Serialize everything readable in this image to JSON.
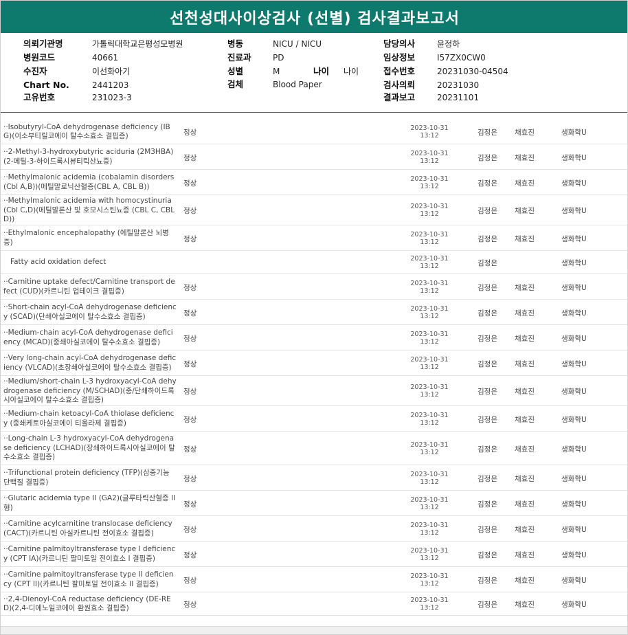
{
  "title": "선천성대사이상검사 (선별) 검사결과보고서",
  "info": {
    "col1": [
      {
        "key": "의뢰기관명",
        "value": "가톨릭대학교은평성모병원"
      },
      {
        "key": "병원코드",
        "value": "40661"
      },
      {
        "key": "수진자",
        "value": "이선화아기"
      },
      {
        "key": "Chart No.",
        "value": "2441203"
      },
      {
        "key": "고유번호",
        "value": "231023-3"
      }
    ],
    "col2": [
      {
        "key": "병동",
        "value": "NICU / NICU"
      },
      {
        "key": "진료과",
        "value": "PD"
      },
      {
        "key": "성별",
        "value": "M"
      },
      {
        "key": "검체",
        "value": "Blood Paper"
      }
    ],
    "age": {
      "key": "나이",
      "value": "나이"
    },
    "col3": [
      {
        "key": "담당의사",
        "value": "윤정하"
      },
      {
        "key": "임상정보",
        "value": "I57ZX0CW0"
      },
      {
        "key": "접수번호",
        "value": "20231030-04504"
      },
      {
        "key": "검사의뢰",
        "value": "20231030"
      },
      {
        "key": "결과보고",
        "value": "20231101"
      }
    ]
  },
  "rows": [
    {
      "name": "··Isobutyryl-CoA dehydrogenase deficiency (IBG)(이소부티릴코에이 탈수소효소 결핍증)",
      "result": "정상",
      "date": "2023-10-31",
      "time": "13:12",
      "p1": "김정은",
      "p2": "채효진",
      "dept": "생화학U"
    },
    {
      "name": "··2-Methyl-3-hydroxybutyric aciduria (2M3HBA)(2-메틸-3-하이드록시뷰티릭산뇨증)",
      "result": "정상",
      "date": "2023-10-31",
      "time": "13:12",
      "p1": "김정은",
      "p2": "채효진",
      "dept": "생화학U"
    },
    {
      "name": "··Methylmalonic acidemia (cobalamin disorders (Cbl A,B))(메틸말로닉산혈증(CBL A, CBL B))",
      "result": "정상",
      "date": "2023-10-31",
      "time": "13:12",
      "p1": "김정은",
      "p2": "채효진",
      "dept": "생화학U"
    },
    {
      "name": "··Methylmalonic acidemia with homocystinuria (Cbl C,D)(메틸말론산 및 호모시스틴뇨증 (CBL C, CBL D))",
      "result": "정상",
      "date": "2023-10-31",
      "time": "13:12",
      "p1": "김정은",
      "p2": "채효진",
      "dept": "생화학U"
    },
    {
      "name": "··Ethylmalonic encephalopathy (에틸말론산 뇌병증)",
      "result": "정상",
      "date": "2023-10-31",
      "time": "13:12",
      "p1": "김정은",
      "p2": "채효진",
      "dept": "생화학U"
    },
    {
      "name": "Fatty acid oxidation defect",
      "result": "",
      "date": "2023-10-31",
      "time": "13:12",
      "p1": "김정은",
      "p2": "",
      "dept": "생화학U",
      "plain": true
    },
    {
      "name": "··Carnitine uptake defect/Carnitine transport defect (CUD)(카르니틴 업테이크 결핍증)",
      "result": "정상",
      "date": "2023-10-31",
      "time": "13:12",
      "p1": "김정은",
      "p2": "채효진",
      "dept": "생화학U"
    },
    {
      "name": "··Short-chain acyl-CoA dehydrogenase deficiency (SCAD)(단쇄아실코에이 탈수소효소 결핍증)",
      "result": "정상",
      "date": "2023-10-31",
      "time": "13:12",
      "p1": "김정은",
      "p2": "채효진",
      "dept": "생화학U"
    },
    {
      "name": "··Medium-chain acyl-CoA dehydrogenase deficiency (MCAD)(중쇄아실코에이 탈수소효소 결핍증)",
      "result": "정상",
      "date": "2023-10-31",
      "time": "13:12",
      "p1": "김정은",
      "p2": "채효진",
      "dept": "생화학U"
    },
    {
      "name": "··Very long-chain acyl-CoA dehydrogenase deficiency (VLCAD)(초장쇄아실코에이 탈수소효소 결핍증)",
      "result": "정상",
      "date": "2023-10-31",
      "time": "13:12",
      "p1": "김정은",
      "p2": "채효진",
      "dept": "생화학U"
    },
    {
      "name": "··Medium/short-chain L-3 hydroxyacyl-CoA dehydrogenase deficiency (M/SCHAD)(중/단쇄하이드록시아실코에이 탈수소효소 결핍증)",
      "result": "정상",
      "date": "2023-10-31",
      "time": "13:12",
      "p1": "김정은",
      "p2": "채효진",
      "dept": "생화학U"
    },
    {
      "name": "··Medium-chain ketoacyl-CoA thiolase deficiency (중쇄케토아실코에이 티올라제 결핍증)",
      "result": "정상",
      "date": "2023-10-31",
      "time": "13:12",
      "p1": "김정은",
      "p2": "채효진",
      "dept": "생화학U"
    },
    {
      "name": "··Long-chain L-3 hydroxyacyl-CoA dehydrogenase deficiency (LCHAD)(장쇄하이드록시아실코에이 탈수소효소 결핍증)",
      "result": "정상",
      "date": "2023-10-31",
      "time": "13:12",
      "p1": "김정은",
      "p2": "채효진",
      "dept": "생화학U"
    },
    {
      "name": "··Trifunctional protein deficiency (TFP)(삼중기능 단백질 결핍증)",
      "result": "정상",
      "date": "2023-10-31",
      "time": "13:12",
      "p1": "김정은",
      "p2": "채효진",
      "dept": "생화학U"
    },
    {
      "name": "··Glutaric acidemia type II (GA2)(글루타릭산혈증 II형)",
      "result": "정상",
      "date": "2023-10-31",
      "time": "13:12",
      "p1": "김정은",
      "p2": "채효진",
      "dept": "생화학U"
    },
    {
      "name": "··Carnitine acylcarnitine translocase deficiency (CACT)(카르니틴 아실카르니틴 전이효소 결핍증)",
      "result": "정상",
      "date": "2023-10-31",
      "time": "13:12",
      "p1": "김정은",
      "p2": "채효진",
      "dept": "생화학U"
    },
    {
      "name": "··Carnitine palmitoyltransferase type I deficiency (CPT IA)(카르니틴 팔미토일 전이효소 I 결핍증)",
      "result": "정상",
      "date": "2023-10-31",
      "time": "13:12",
      "p1": "김정은",
      "p2": "채효진",
      "dept": "생화학U"
    },
    {
      "name": "··Carnitine palmitoyltransferase type II deficiency (CPT II)(카르니틴 팔미토일 전이효소 II 결핍증)",
      "result": "정상",
      "date": "2023-10-31",
      "time": "13:12",
      "p1": "김정은",
      "p2": "채효진",
      "dept": "생화학U"
    },
    {
      "name": "··2,4-Dienoyl-CoA reductase deficiency (DE-RED)(2,4-디에노일코에이 환원효소 결핍증)",
      "result": "정상",
      "date": "2023-10-31",
      "time": "13:12",
      "p1": "김정은",
      "p2": "채효진",
      "dept": "생화학U"
    }
  ]
}
